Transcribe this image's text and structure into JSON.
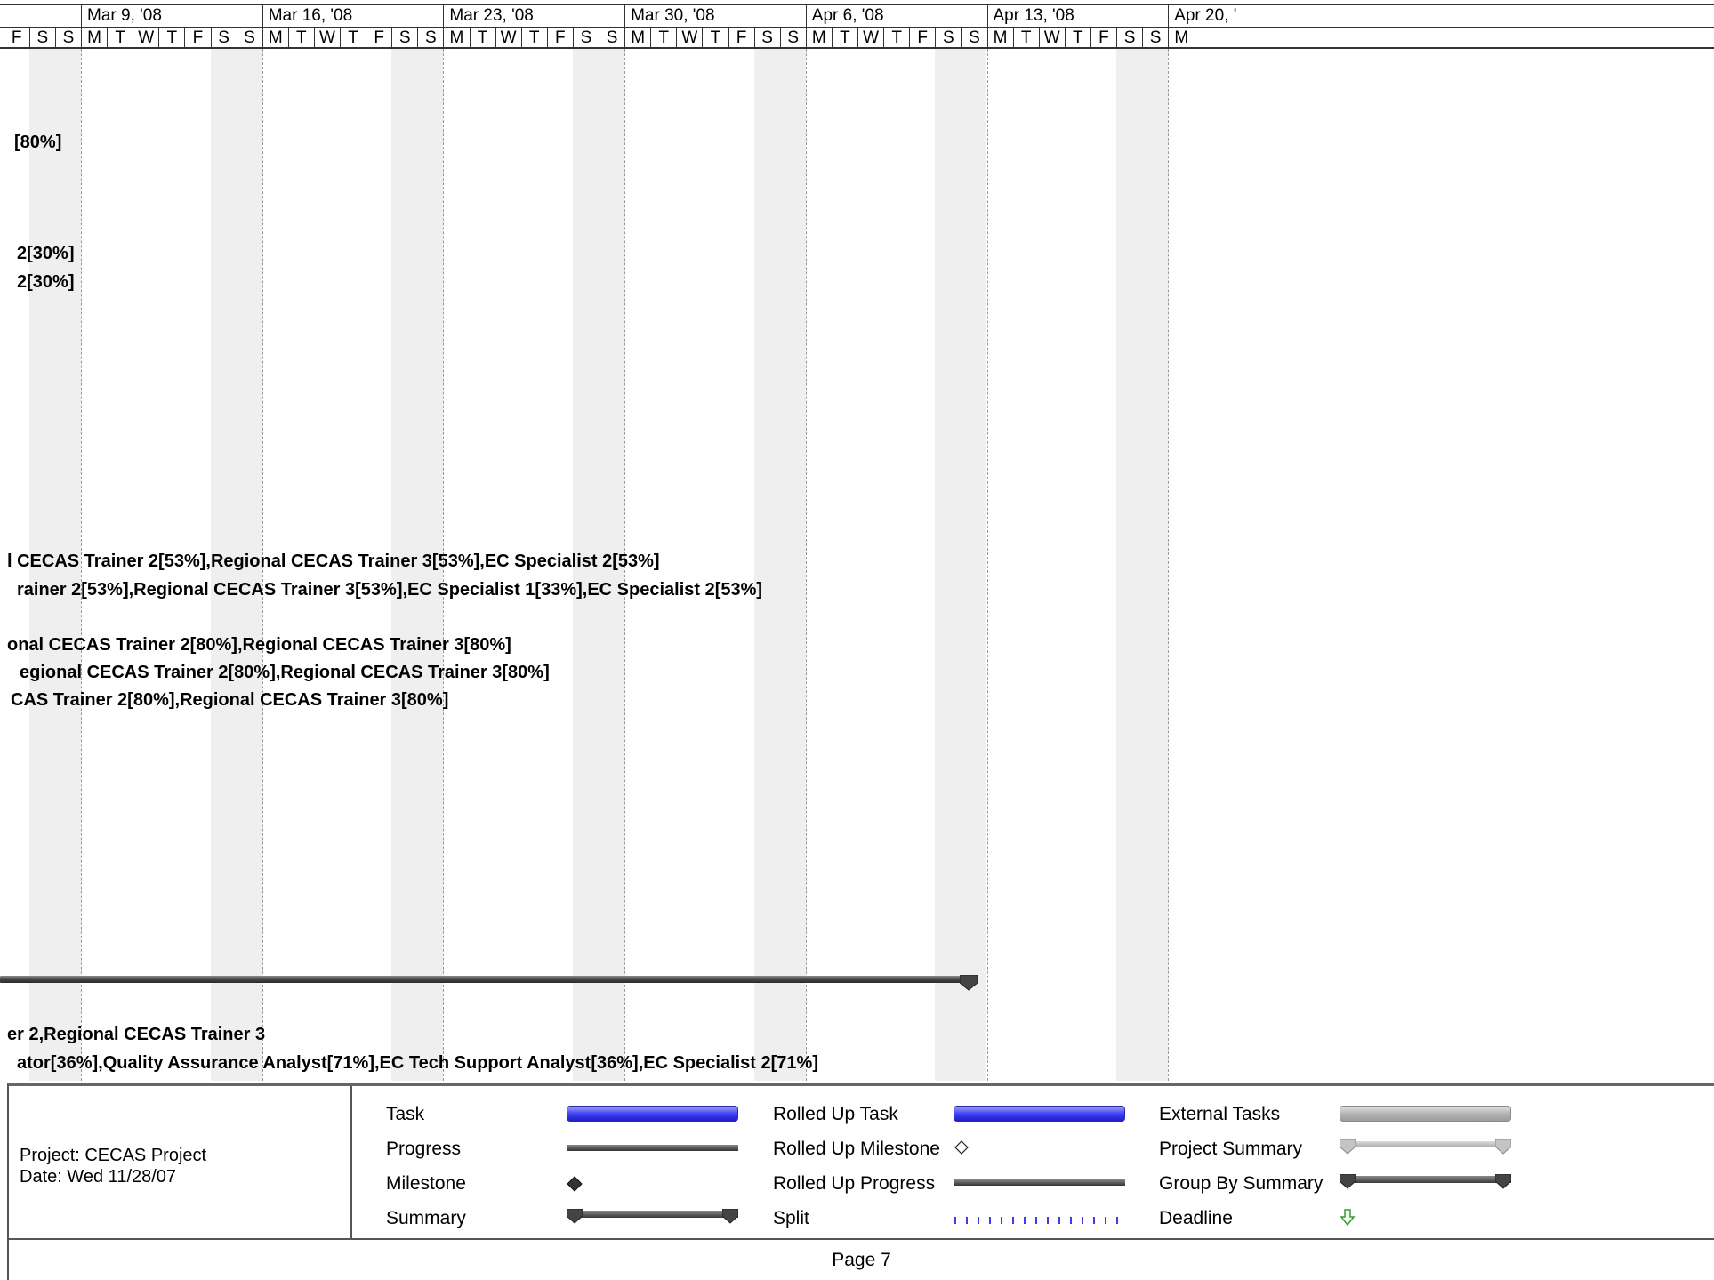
{
  "timescale": {
    "weeks": [
      "Mar 9, '08",
      "Mar 16, '08",
      "Mar 23, '08",
      "Mar 30, '08",
      "Apr 6, '08",
      "Apr 13, '08",
      "Apr 20, '"
    ],
    "days": [
      "F",
      "S",
      "S",
      "M",
      "T",
      "W",
      "T",
      "F",
      "S",
      "S",
      "M",
      "T",
      "W",
      "T",
      "F",
      "S",
      "S",
      "M",
      "T",
      "W",
      "T",
      "F",
      "S",
      "S",
      "M",
      "T",
      "W",
      "T",
      "F",
      "S",
      "S",
      "M",
      "T",
      "W",
      "T",
      "F",
      "S",
      "S",
      "M",
      "T",
      "W",
      "T",
      "F",
      "S",
      "S",
      "M"
    ]
  },
  "rows": [
    "[80%]",
    "2[30%]",
    "2[30%]",
    "l CECAS Trainer 2[53%],Regional CECAS Trainer 3[53%],EC Specialist 2[53%]",
    "rainer 2[53%],Regional CECAS Trainer 3[53%],EC Specialist 1[33%],EC Specialist 2[53%]",
    "onal CECAS Trainer 2[80%],Regional CECAS Trainer 3[80%]",
    "egional CECAS Trainer 2[80%],Regional CECAS Trainer 3[80%]",
    "CAS Trainer 2[80%],Regional CECAS Trainer 3[80%]",
    "er 2,Regional CECAS Trainer 3",
    "ator[36%],Quality Assurance Analyst[71%],EC Tech Support Analyst[36%],EC Specialist 2[71%]"
  ],
  "legend": {
    "project": "Project: CECAS Project",
    "date": "Date: Wed 11/28/07",
    "items": [
      "Task",
      "Progress",
      "Milestone",
      "Summary",
      "Rolled Up Task",
      "Rolled Up Milestone",
      "Rolled Up Progress",
      "Split",
      "External Tasks",
      "Project Summary",
      "Group By Summary",
      "Deadline"
    ]
  },
  "colors": {
    "task": "#3a3cf2",
    "summary": "#333333",
    "external": "#b0b0b0",
    "deadline": "#2ea02e",
    "split": "#3a3cf2"
  },
  "icons": {
    "milestone": "diamond-filled",
    "rolled_up_milestone": "diamond-outline",
    "deadline": "down-arrow-outline"
  },
  "footer": {
    "page": "Page 7"
  }
}
